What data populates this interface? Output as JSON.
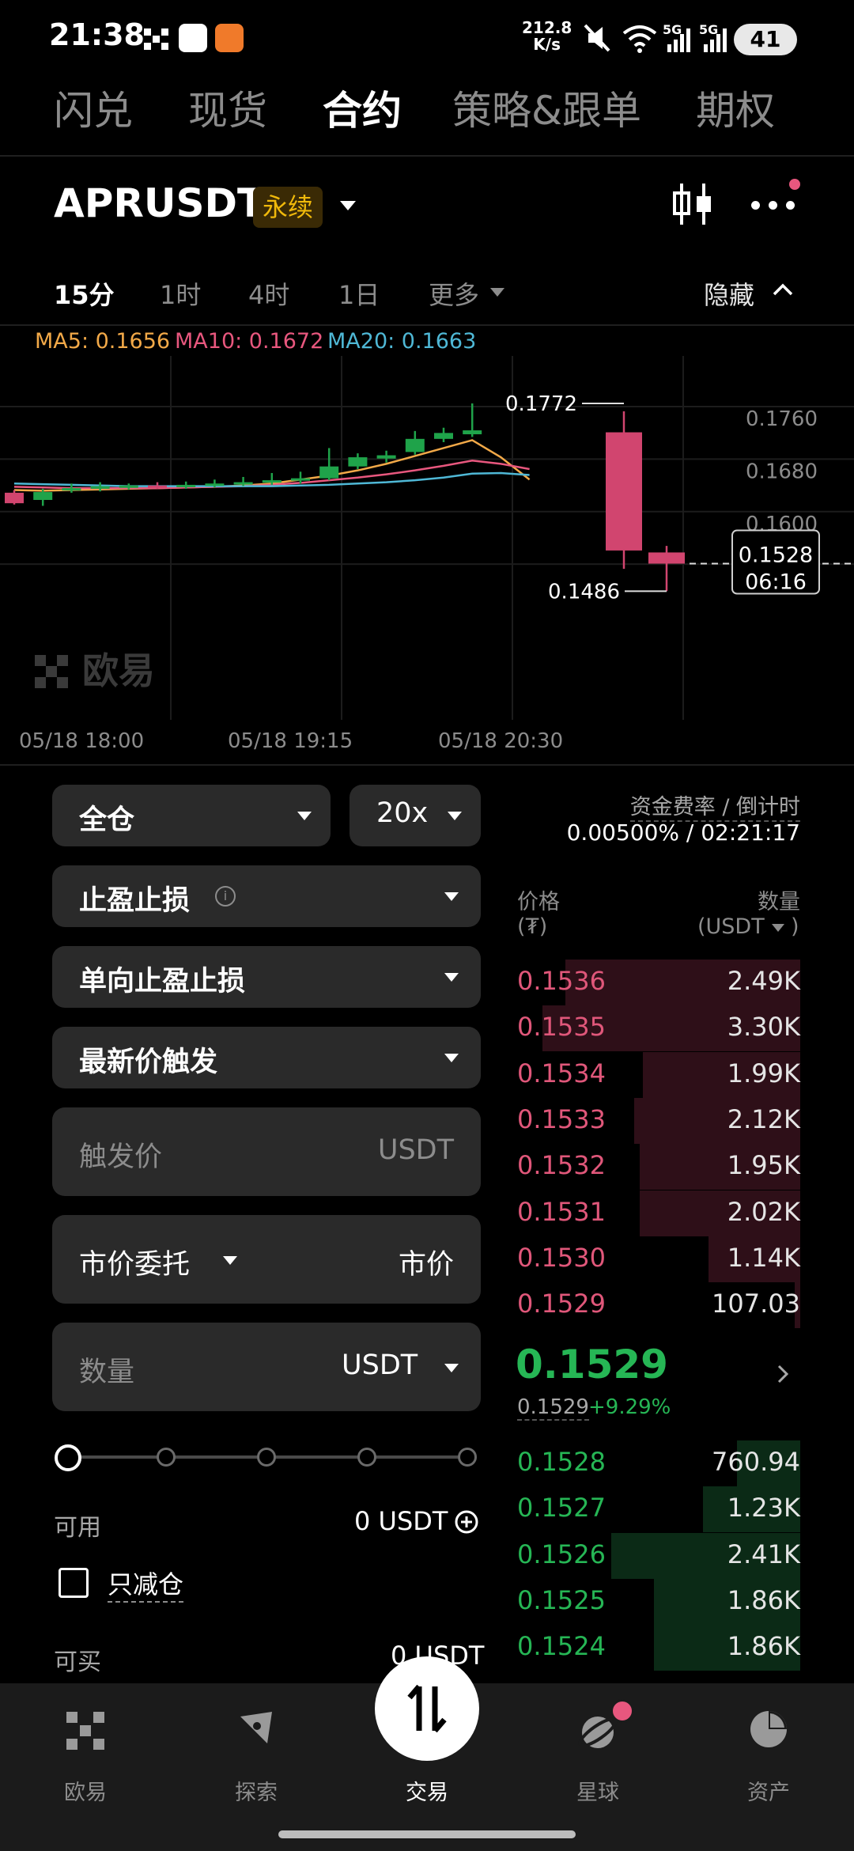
{
  "status_bar": {
    "time": "21:38",
    "speed_value": "212.8",
    "speed_unit": "K/s",
    "signal_1": "5G",
    "signal_2": "5G",
    "battery": "41"
  },
  "top_tabs": [
    "闪兑",
    "现货",
    "合约",
    "策略&跟单",
    "期权"
  ],
  "active_tab": "合约",
  "symbol": {
    "name": "APRUSDT",
    "badge": "永续"
  },
  "timeframes": {
    "items": [
      "15分",
      "1时",
      "4时",
      "1日",
      "更多"
    ],
    "active": "15分",
    "hide": "隐藏"
  },
  "indicators": {
    "ma5": "MA5: 0.1656",
    "ma10": "MA10: 0.1672",
    "ma20": "MA20: 0.1663",
    "ma5_color": "#f2a948",
    "ma10_color": "#e8577e",
    "ma20_color": "#4fb8d6"
  },
  "chart_data": {
    "type": "candlestick",
    "y_ticks": [
      "0.1760",
      "0.1680",
      "0.1600"
    ],
    "x_ticks": [
      "05/18 18:00",
      "05/18 19:15",
      "05/18 20:30"
    ],
    "high_label": "0.1772",
    "low_label": "0.1486",
    "current_price": "0.1528",
    "countdown": "06:16",
    "watermark": "欧易",
    "candles": [
      {
        "o": 0.1636,
        "c": 0.162,
        "h": 0.164,
        "l": 0.1618
      },
      {
        "o": 0.1625,
        "c": 0.1637,
        "h": 0.1642,
        "l": 0.1616
      },
      {
        "o": 0.164,
        "c": 0.1643,
        "h": 0.165,
        "l": 0.1636
      },
      {
        "o": 0.1642,
        "c": 0.1646,
        "h": 0.1652,
        "l": 0.1638
      },
      {
        "o": 0.1644,
        "c": 0.1647,
        "h": 0.165,
        "l": 0.1641
      },
      {
        "o": 0.1647,
        "c": 0.1645,
        "h": 0.1652,
        "l": 0.1642
      },
      {
        "o": 0.1645,
        "c": 0.1648,
        "h": 0.1653,
        "l": 0.1642
      },
      {
        "o": 0.1648,
        "c": 0.165,
        "h": 0.1656,
        "l": 0.1644
      },
      {
        "o": 0.1649,
        "c": 0.1652,
        "h": 0.166,
        "l": 0.1646
      },
      {
        "o": 0.1652,
        "c": 0.1655,
        "h": 0.1666,
        "l": 0.1648
      },
      {
        "o": 0.1655,
        "c": 0.1658,
        "h": 0.1668,
        "l": 0.165
      },
      {
        "o": 0.1658,
        "c": 0.1676,
        "h": 0.1704,
        "l": 0.1655
      },
      {
        "o": 0.1676,
        "c": 0.169,
        "h": 0.1696,
        "l": 0.1672
      },
      {
        "o": 0.1688,
        "c": 0.1693,
        "h": 0.17,
        "l": 0.1682
      },
      {
        "o": 0.1698,
        "c": 0.1718,
        "h": 0.173,
        "l": 0.1694
      },
      {
        "o": 0.1718,
        "c": 0.1727,
        "h": 0.1735,
        "l": 0.1713
      },
      {
        "o": 0.1725,
        "c": 0.1731,
        "h": 0.1772,
        "l": 0.1721
      },
      {
        "o": 0.1728,
        "c": 0.1548,
        "h": 0.176,
        "l": 0.152
      },
      {
        "o": 0.1545,
        "c": 0.1528,
        "h": 0.1555,
        "l": 0.1486
      }
    ],
    "ma5": [
      0.164,
      0.1639,
      0.164,
      0.1641,
      0.1642,
      0.1643,
      0.1644,
      0.1645,
      0.1647,
      0.165,
      0.1656,
      0.1662,
      0.167,
      0.168,
      0.1692,
      0.1704,
      0.1716,
      0.169,
      0.1656
    ],
    "ma10": [
      0.1645,
      0.1644,
      0.1643,
      0.1643,
      0.1643,
      0.1643,
      0.1644,
      0.1645,
      0.1646,
      0.1648,
      0.1651,
      0.1655,
      0.1659,
      0.1664,
      0.167,
      0.1677,
      0.1685,
      0.168,
      0.1672
    ],
    "ma20": [
      0.165,
      0.1649,
      0.1648,
      0.1647,
      0.1646,
      0.1646,
      0.1646,
      0.1646,
      0.1646,
      0.1646,
      0.1647,
      0.1648,
      0.165,
      0.1652,
      0.1655,
      0.1659,
      0.1665,
      0.1666,
      0.1663
    ],
    "up_color": "#1fa34a",
    "down_color": "#d1456f"
  },
  "form": {
    "margin_mode": "全仓",
    "leverage": "20x",
    "tp_sl": "止盈止损",
    "tp_sl_mode": "单向止盈止损",
    "trigger_type": "最新价触发",
    "trigger_price_placeholder": "触发价",
    "trigger_unit": "USDT",
    "order_type": "市价委托",
    "order_price": "市价",
    "qty_placeholder": "数量",
    "qty_unit": "USDT",
    "available_label": "可用",
    "available_value": "0 USDT",
    "reduce_only": "只减仓",
    "can_buy_label": "可买",
    "can_buy_value": "0 USDT"
  },
  "funding": {
    "label": "资金费率 / 倒计时",
    "value": "0.00500% / 02:21:17"
  },
  "orderbook": {
    "price_label": "价格",
    "price_unit": "(₮)",
    "qty_label": "数量",
    "qty_unit": "(USDT",
    "asks": [
      {
        "price": "0.1536",
        "qty": "2.49K",
        "depth": 0.82
      },
      {
        "price": "0.1535",
        "qty": "3.30K",
        "depth": 0.9
      },
      {
        "price": "0.1534",
        "qty": "1.99K",
        "depth": 0.55
      },
      {
        "price": "0.1533",
        "qty": "2.12K",
        "depth": 0.58
      },
      {
        "price": "0.1532",
        "qty": "1.95K",
        "depth": 0.56
      },
      {
        "price": "0.1531",
        "qty": "2.02K",
        "depth": 0.56
      },
      {
        "price": "0.1530",
        "qty": "1.14K",
        "depth": 0.32
      },
      {
        "price": "0.1529",
        "qty": "107.03",
        "depth": 0.02
      }
    ],
    "last_price": "0.1529",
    "mark_price": "0.1529",
    "change": "+9.29%",
    "bids": [
      {
        "price": "0.1528",
        "qty": "760.94",
        "depth": 0.22
      },
      {
        "price": "0.1527",
        "qty": "1.23K",
        "depth": 0.34
      },
      {
        "price": "0.1526",
        "qty": "2.41K",
        "depth": 0.66
      },
      {
        "price": "0.1525",
        "qty": "1.86K",
        "depth": 0.51
      },
      {
        "price": "0.1524",
        "qty": "1.86K",
        "depth": 0.51
      }
    ],
    "ask_color": "#e0577a",
    "bid_color": "#26b655"
  },
  "bottom_nav": [
    "欧易",
    "探索",
    "交易",
    "星球",
    "资产"
  ]
}
